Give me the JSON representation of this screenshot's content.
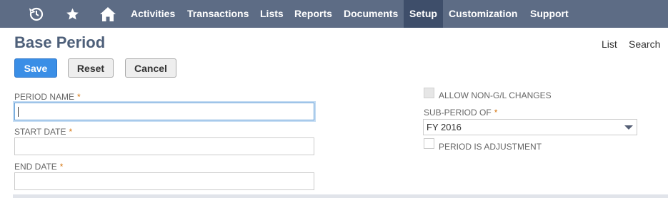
{
  "nav": {
    "icons": [
      {
        "name": "recent-history-icon"
      },
      {
        "name": "star-icon"
      },
      {
        "name": "home-icon"
      }
    ],
    "items": [
      "Activities",
      "Transactions",
      "Lists",
      "Reports",
      "Documents",
      "Setup",
      "Customization",
      "Support"
    ],
    "active": "Setup",
    "colors": {
      "bar": "#5d6c85",
      "active": "#3e4e6a"
    }
  },
  "page": {
    "title": "Base Period",
    "links": {
      "list": "List",
      "search": "Search"
    }
  },
  "buttons": {
    "save": "Save",
    "reset": "Reset",
    "cancel": "Cancel"
  },
  "form": {
    "period_name": {
      "label": "PERIOD NAME",
      "required": "*",
      "value": ""
    },
    "start_date": {
      "label": "START DATE",
      "required": "*",
      "value": ""
    },
    "end_date": {
      "label": "END DATE",
      "required": "*",
      "value": ""
    },
    "allow_non_gl": {
      "label": "ALLOW NON-G/L CHANGES",
      "checked": false,
      "disabled": true
    },
    "sub_period_of": {
      "label": "SUB-PERIOD OF",
      "required": "*",
      "value": "FY 2016"
    },
    "period_is_adjustment": {
      "label": "PERIOD IS ADJUSTMENT",
      "checked": false
    }
  },
  "colors": {
    "primary_button": "#3a8ee6",
    "title": "#4d5f79",
    "required": "#d5750f"
  }
}
